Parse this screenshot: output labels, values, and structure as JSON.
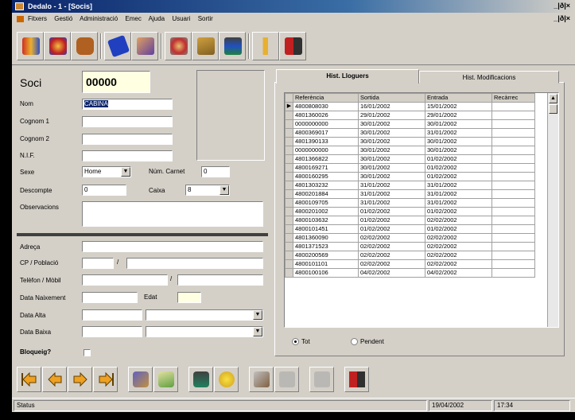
{
  "window": {
    "title": "Dedalo - 1 - [Socis]",
    "controls": "_|ð|×",
    "mdi_controls": "_|ð|×"
  },
  "menu": [
    "Fitxers",
    "Gestió",
    "Administració",
    "Emec",
    "Ajuda",
    "Usuari",
    "Sortir"
  ],
  "toolbar_icons": [
    "users-group-icon",
    "people-icon",
    "bag-icon",
    "disk-icon",
    "hands-icon",
    "person-gear-icon",
    "books-icon",
    "stack-icon",
    "info-person-icon",
    "exit-door-icon"
  ],
  "form": {
    "soci_label": "Soci",
    "soci_code": "00000",
    "nom_label": "Nom",
    "nom_value": "CABINA",
    "cognom1_label": "Cognom 1",
    "cognom2_label": "Cognom 2",
    "nif_label": "N.I.F.",
    "sexe_label": "Sexe",
    "sexe_value": "Home",
    "num_carnet_label": "Núm. Carnet",
    "num_carnet_value": "0",
    "descompte_label": "Descompte",
    "descompte_value": "0",
    "caixa_label": "Caixa",
    "caixa_value": "8",
    "observacions_label": "Observacions",
    "adreca_label": "Adreça",
    "cp_label": "CP / Població",
    "cp_sep": "/",
    "telefon_label": "Telèfon / Mòbil",
    "telefon_sep": "/",
    "naixement_label": "Data Naixement",
    "edat_label": "Edat",
    "alta_label": "Data Alta",
    "baixa_label": "Data Baixa",
    "bloqueig_label": "Bloqueig?"
  },
  "tabs": [
    "Hist. Lloguers",
    "Hist. Modificacions"
  ],
  "grid": {
    "columns": [
      "Referència",
      "Sortida",
      "Entrada",
      "Recàrrec"
    ],
    "rows": [
      [
        "4800808030",
        "16/01/2002",
        "15/01/2002",
        ""
      ],
      [
        "4801360026",
        "29/01/2002",
        "29/01/2002",
        ""
      ],
      [
        "0000000000",
        "30/01/2002",
        "30/01/2002",
        ""
      ],
      [
        "4800369017",
        "30/01/2002",
        "31/01/2002",
        ""
      ],
      [
        "4801390133",
        "30/01/2002",
        "30/01/2002",
        ""
      ],
      [
        "0000000000",
        "30/01/2002",
        "30/01/2002",
        ""
      ],
      [
        "4801366822",
        "30/01/2002",
        "01/02/2002",
        ""
      ],
      [
        "4800169271",
        "30/01/2002",
        "01/02/2002",
        ""
      ],
      [
        "4800160295",
        "30/01/2002",
        "01/02/2002",
        ""
      ],
      [
        "4801303232",
        "31/01/2002",
        "31/01/2002",
        ""
      ],
      [
        "4800201884",
        "31/01/2002",
        "31/01/2002",
        ""
      ],
      [
        "4800109705",
        "31/01/2002",
        "31/01/2002",
        ""
      ],
      [
        "4800201002",
        "01/02/2002",
        "01/02/2002",
        ""
      ],
      [
        "4800103632",
        "01/02/2002",
        "02/02/2002",
        ""
      ],
      [
        "4800101451",
        "01/02/2002",
        "01/02/2002",
        ""
      ],
      [
        "4801360090",
        "02/02/2002",
        "02/02/2002",
        ""
      ],
      [
        "4801371523",
        "02/02/2002",
        "02/02/2002",
        ""
      ],
      [
        "4800200569",
        "02/02/2002",
        "02/02/2002",
        ""
      ],
      [
        "4800101101",
        "02/02/2002",
        "02/02/2002",
        ""
      ],
      [
        "4800100106",
        "04/02/2002",
        "04/02/2002",
        ""
      ]
    ]
  },
  "filter": {
    "tot_label": "Tot",
    "pendent_label": "Pendent",
    "selected": "Tot"
  },
  "nav_icons": [
    "first-arrow-icon",
    "prev-arrow-icon",
    "next-arrow-icon",
    "last-arrow-icon",
    "new-user-icon",
    "edit-icon",
    "delete-icon",
    "search-icon",
    "print-icon",
    "save-icon",
    "cancel-icon",
    "exit-door-icon"
  ],
  "status": {
    "text": "Status",
    "date": "19/04/2002",
    "time": "17:34"
  },
  "colors": {
    "titlebar": "#0a246a",
    "face": "#d4d0c8",
    "code_bg": "#ffffe1",
    "nav_arrow": "#f0a020"
  }
}
